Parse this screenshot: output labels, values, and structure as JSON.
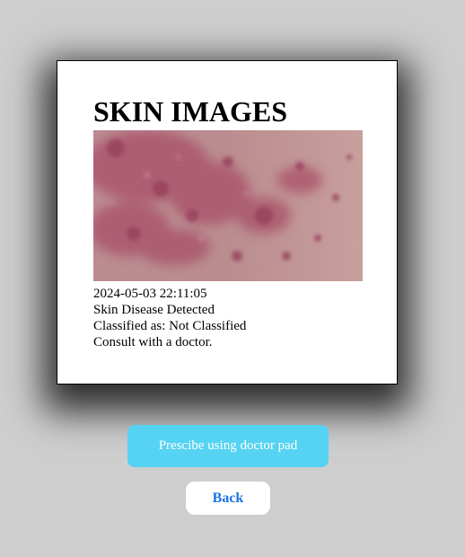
{
  "card": {
    "title": "SKIN IMAGES",
    "image_subject": "skin-rash-photo",
    "timestamp": "2024-05-03 22:11:05",
    "status": "Skin Disease Detected",
    "classification": "Classified as: Not Classified",
    "advice": "Consult with a doctor."
  },
  "actions": {
    "prescribe_label": "Prescibe using doctor pad",
    "back_label": "Back"
  },
  "colors": {
    "background": "#cecece",
    "prescribe_button": "#56d3f2",
    "back_text": "#1a73e8"
  }
}
